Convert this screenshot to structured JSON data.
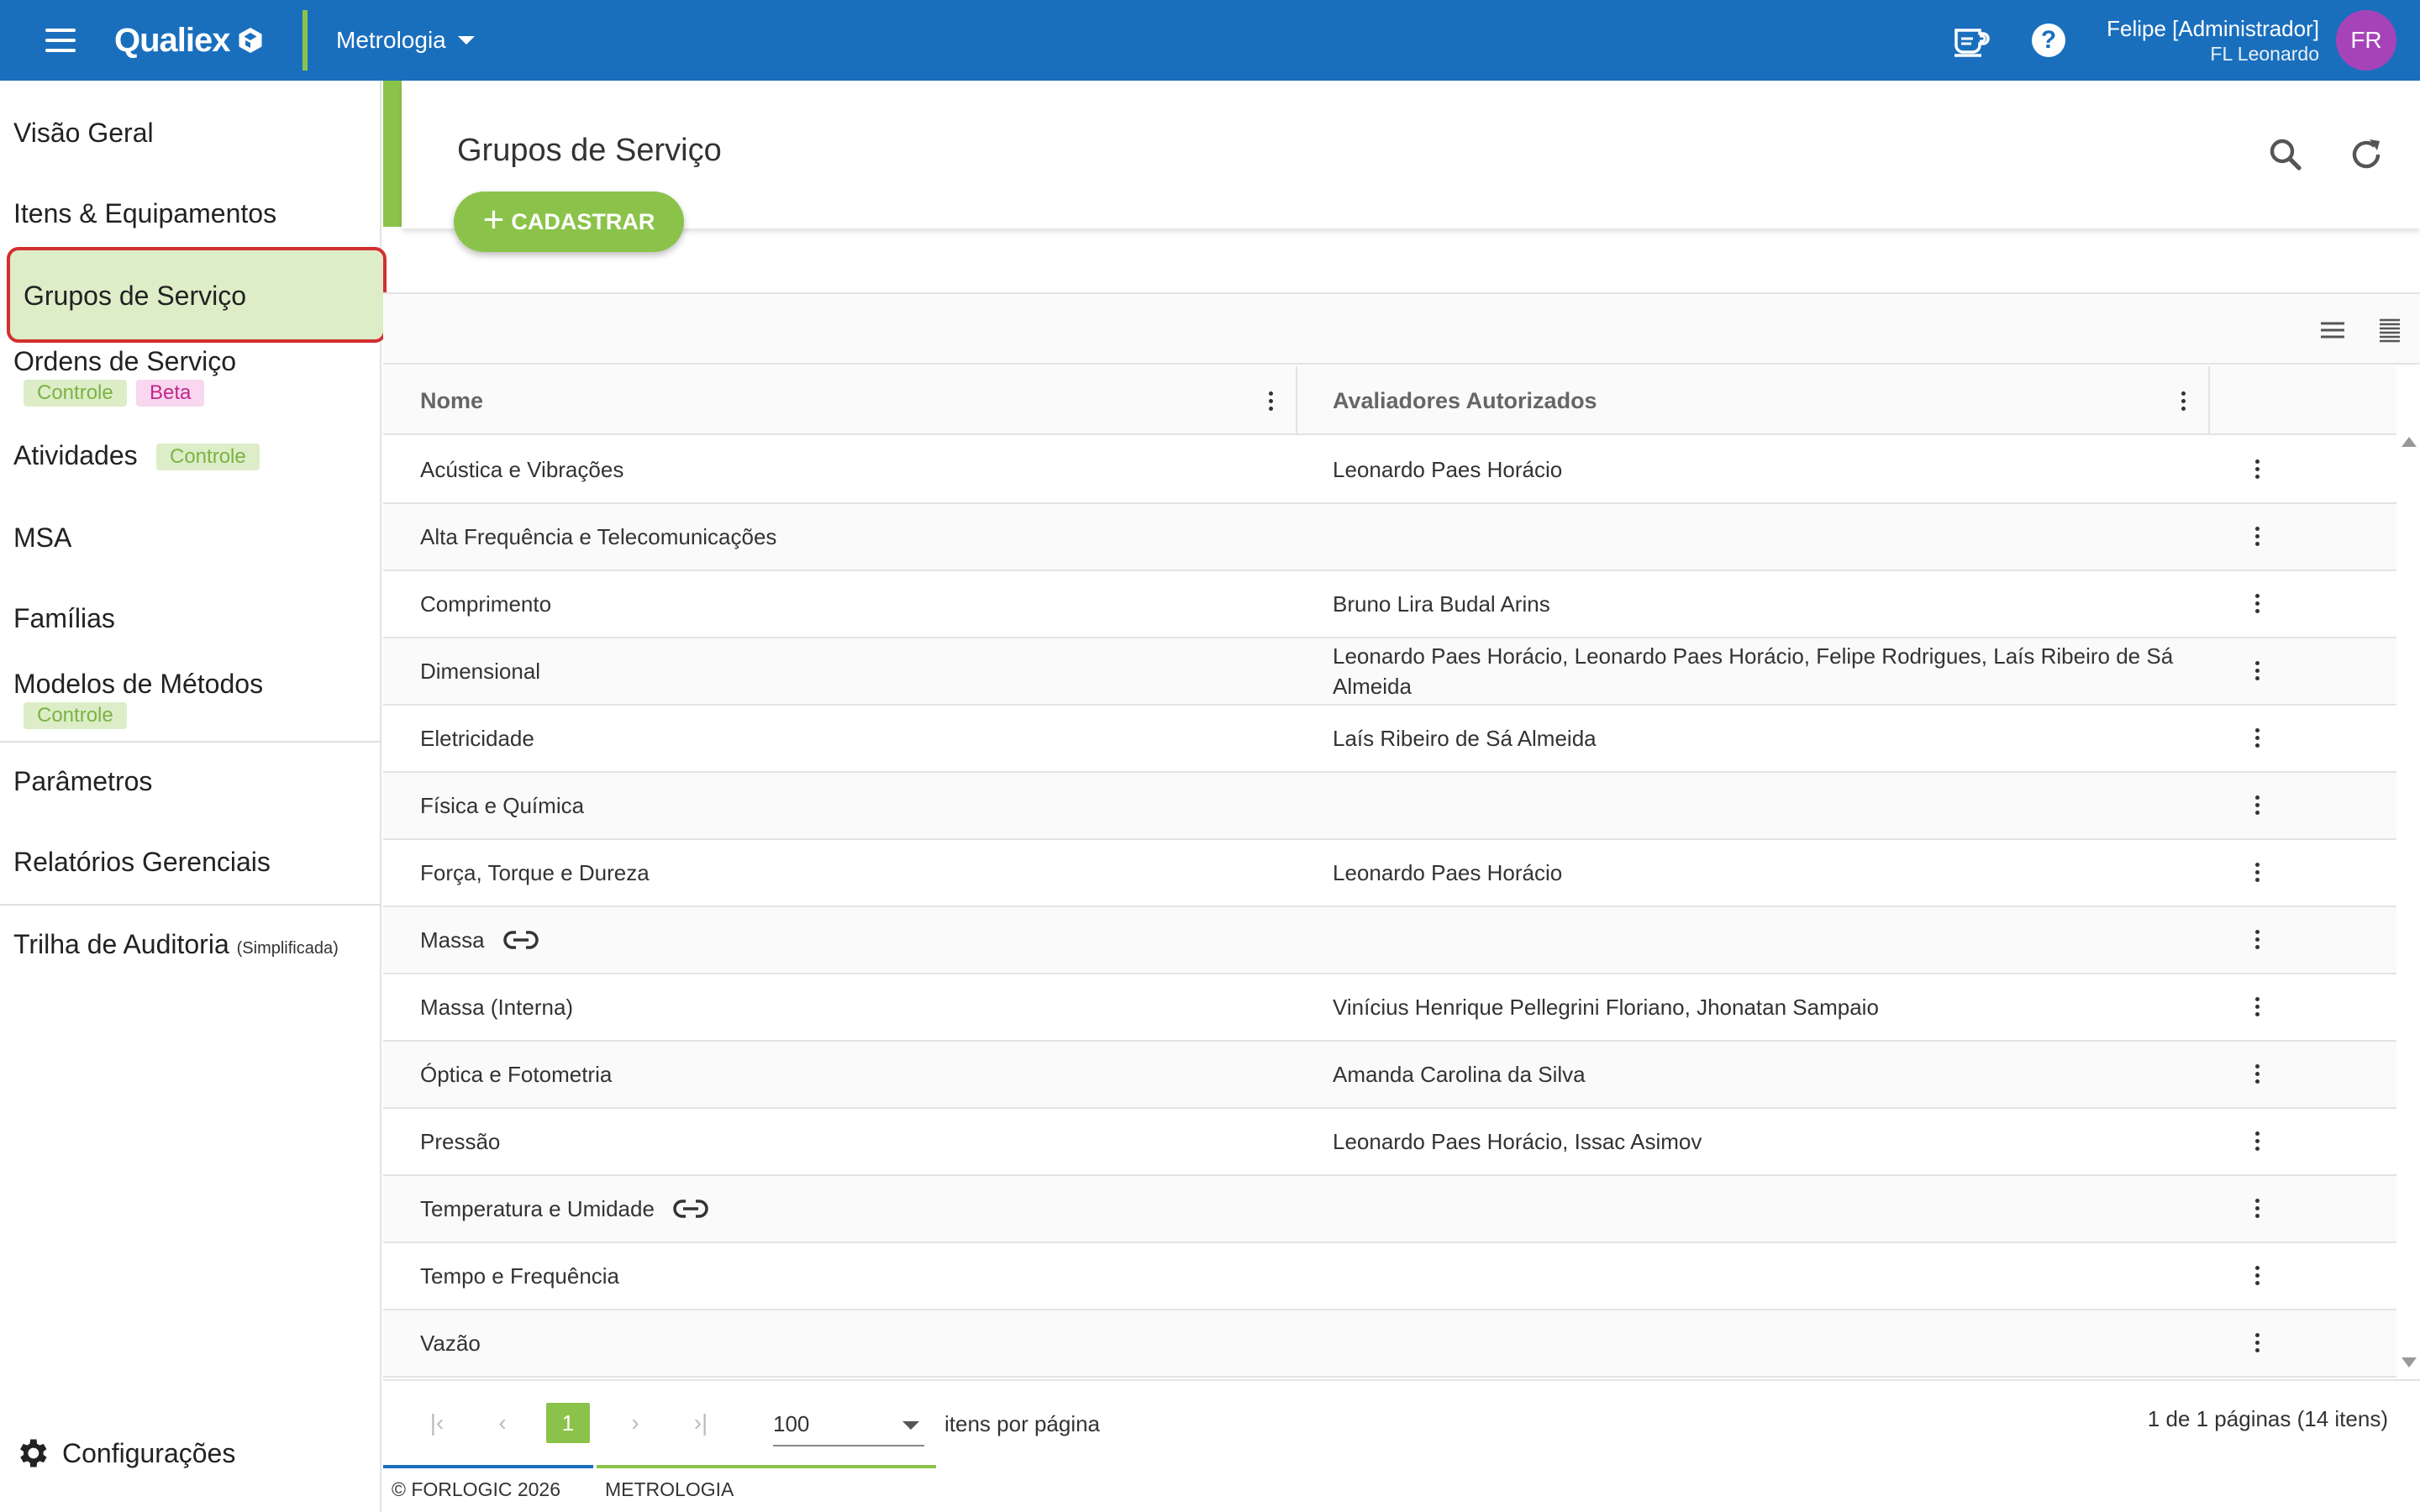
{
  "app": {
    "brand": "Qualiex",
    "module": "Metrologia",
    "user_name": "Felipe [Administrador]",
    "user_company": "FL Leonardo",
    "avatar_initials": "FR",
    "colors": {
      "topbar": "#1a6fbd",
      "accent_green": "#8bc34a",
      "avatar": "#a743b8",
      "highlight_border": "#d32f2f"
    }
  },
  "sidebar": {
    "items": [
      {
        "label": "Visão Geral"
      },
      {
        "label": "Itens & Equipamentos"
      },
      {
        "label": "Grupos de Serviço",
        "active": true
      },
      {
        "label": "Ordens de Serviço",
        "tags": [
          "Controle",
          "Beta"
        ]
      },
      {
        "label": "Atividades",
        "tags": [
          "Controle"
        ]
      },
      {
        "label": "MSA"
      },
      {
        "label": "Famílias"
      },
      {
        "label": "Modelos de Métodos",
        "tags": [
          "Controle"
        ]
      },
      {
        "label": "Parâmetros"
      },
      {
        "label": "Relatórios Gerenciais"
      },
      {
        "label": "Trilha de Auditoria",
        "suffix": "(Simplificada)"
      }
    ],
    "settings_label": "Configurações"
  },
  "page": {
    "title": "Grupos de Serviço",
    "add_button": "CADASTRAR"
  },
  "table": {
    "columns": [
      "Nome",
      "Avaliadores Autorizados"
    ],
    "rows": [
      {
        "name": "Acústica e Vibrações",
        "evaluators": "Leonardo Paes Horácio"
      },
      {
        "name": "Alta Frequência e Telecomunicações",
        "evaluators": ""
      },
      {
        "name": "Comprimento",
        "evaluators": "Bruno Lira Budal Arins"
      },
      {
        "name": "Dimensional",
        "evaluators": "Leonardo Paes Horácio, Leonardo Paes Horácio, Felipe Rodrigues, Laís Ribeiro de Sá Almeida"
      },
      {
        "name": "Eletricidade",
        "evaluators": "Laís Ribeiro de Sá Almeida"
      },
      {
        "name": "Física e Química",
        "evaluators": ""
      },
      {
        "name": "Força, Torque e Dureza",
        "evaluators": "Leonardo Paes Horácio"
      },
      {
        "name": "Massa",
        "evaluators": "",
        "linked": true
      },
      {
        "name": "Massa (Interna)",
        "evaluators": "Vinícius Henrique Pellegrini Floriano, Jhonatan Sampaio"
      },
      {
        "name": "Óptica e Fotometria",
        "evaluators": "Amanda Carolina da Silva"
      },
      {
        "name": "Pressão",
        "evaluators": "Leonardo Paes Horácio, Issac Asimov"
      },
      {
        "name": "Temperatura e Umidade",
        "evaluators": "",
        "linked": true
      },
      {
        "name": "Tempo e Frequência",
        "evaluators": ""
      },
      {
        "name": "Vazão",
        "evaluators": ""
      }
    ]
  },
  "pagination": {
    "current_page": "1",
    "per_page": "100",
    "per_page_label": "itens por página",
    "summary": "1 de 1 páginas (14 itens)"
  },
  "footer": {
    "copyright": "© FORLOGIC 2026",
    "module": "METROLOGIA"
  }
}
